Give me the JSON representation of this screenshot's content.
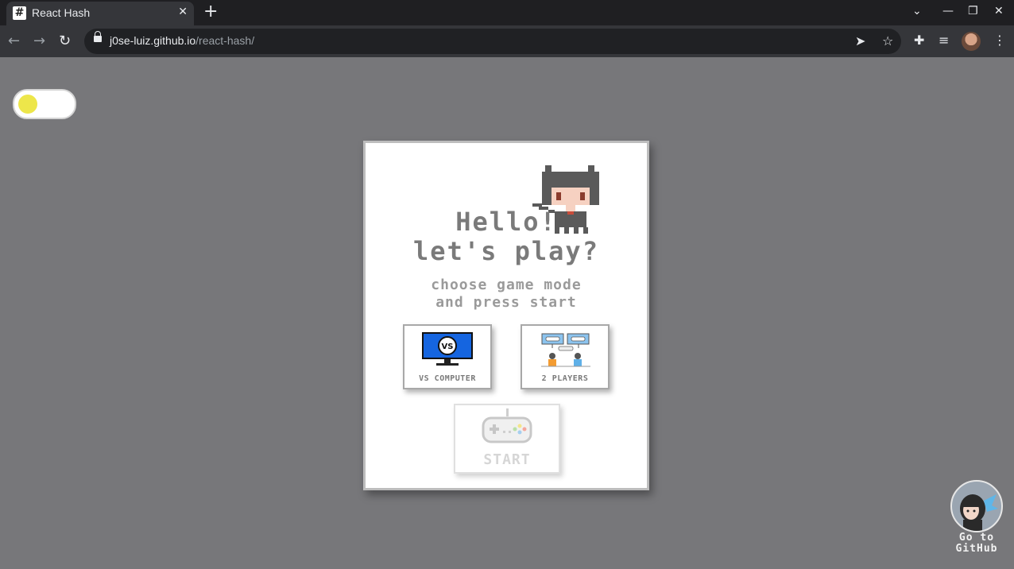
{
  "browser": {
    "tab_title": "React Hash",
    "tab_favicon": "#",
    "url_host": "j0se-luiz.github.io",
    "url_path": "/react-hash/"
  },
  "icons": {
    "back": "arrow-left-icon",
    "forward": "arrow-right-icon",
    "reload": "reload-icon",
    "lock": "lock-icon",
    "send": "send-icon",
    "bookmark": "star-icon",
    "extensions": "puzzle-icon",
    "media": "playlist-icon",
    "menu": "kebab-menu-icon"
  },
  "theme_toggle": {
    "state": "light",
    "knob_color": "#ede64a"
  },
  "card": {
    "title_line1": "Hello!",
    "title_line2": "let's play?",
    "subtitle_line1": "choose game mode",
    "subtitle_line2": "and press start",
    "modes": [
      {
        "label": "VS COMPUTER",
        "icon": "vs-computer-icon"
      },
      {
        "label": "2 PLAYERS",
        "icon": "two-players-icon"
      }
    ],
    "start_label": "START"
  },
  "github_link": {
    "line1": "Go to",
    "line2": "GitHub"
  },
  "colors": {
    "page_bg": "#77777a",
    "card_bg": "#ffffff",
    "text_gray": "#7a7a7a",
    "accent_yellow": "#ede64a",
    "monitor_blue": "#1565e0"
  }
}
